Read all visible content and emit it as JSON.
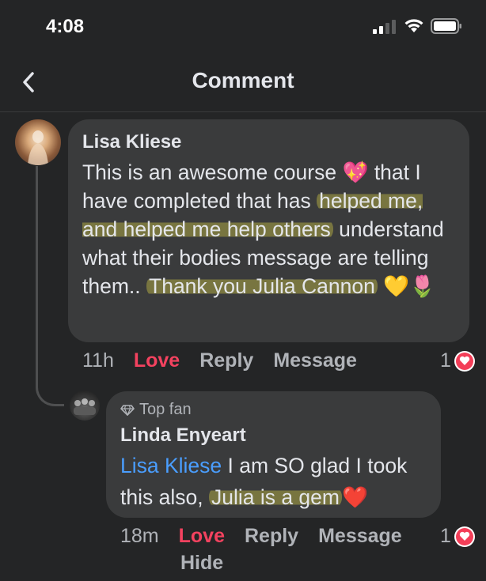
{
  "status": {
    "time": "4:08"
  },
  "nav": {
    "title": "Comment"
  },
  "comment": {
    "author": "Lisa Kliese",
    "text_a": "This is an awesome course ",
    "emoji_a": "💖",
    "text_b": " that I have completed that has ",
    "hl_1": "helped me, and helped me help others",
    "text_c": " understand what their bodies message are telling them.. ",
    "hl_2": "Thank you Julia Cannon",
    "emoji_b": "💛🌷",
    "time": "11h",
    "love": "Love",
    "reply": "Reply",
    "message": "Message",
    "reaction_count": "1"
  },
  "reply": {
    "badge": "Top fan",
    "author": "Linda Enyeart",
    "mention": "Lisa Kliese",
    "text_a": " I am SO glad I took this also, ",
    "hl": "Julia is a gem",
    "emoji": "❤️",
    "time": "18m",
    "love": "Love",
    "reply": "Reply",
    "message": "Message",
    "hide": "Hide",
    "reaction_count": "1"
  },
  "colors": {
    "background": "#242526",
    "bubble": "#3a3b3c",
    "love": "#f3425f",
    "mention": "#4a9eff",
    "heart": "#f33e58"
  }
}
